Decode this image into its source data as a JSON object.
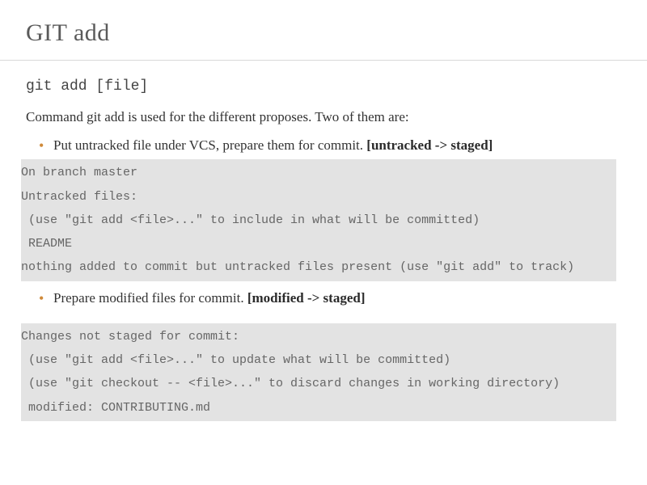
{
  "title": "GIT add",
  "command": "git add [file]",
  "intro": "Command git add is used for the different proposes. Two of them are:",
  "bullets": [
    {
      "text": "Put untracked file under VCS, prepare them for commit. ",
      "tag": "[untracked -> staged]"
    },
    {
      "text": "Prepare modified files for commit. ",
      "tag": "[modified -> staged]"
    }
  ],
  "code1": "On branch master\nUntracked files:\n (use \"git add <file>...\" to include in what will be committed)\n README\nnothing added to commit but untracked files present (use \"git add\" to track)",
  "code2": "Changes not staged for commit:\n (use \"git add <file>...\" to update what will be committed)\n (use \"git checkout -- <file>...\" to discard changes in working directory)\n modified: CONTRIBUTING.md"
}
